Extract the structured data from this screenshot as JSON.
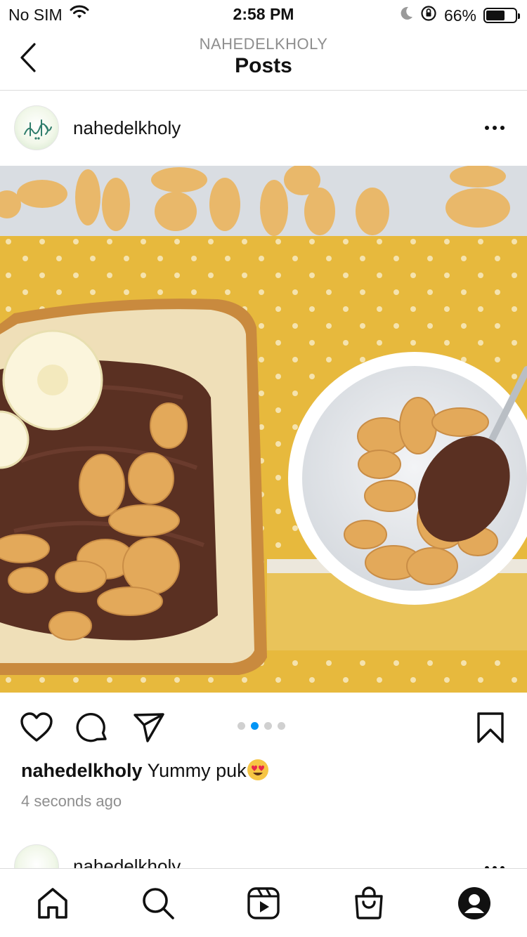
{
  "status_bar": {
    "carrier": "No SIM",
    "time": "2:58 PM",
    "battery_percent": "66%",
    "battery_level": 0.66,
    "icons": [
      "wifi-icon",
      "moon-icon",
      "orientation-lock-icon",
      "battery-icon"
    ]
  },
  "nav": {
    "subtitle": "NAHEDELKHOLY",
    "title": "Posts",
    "back_icon": "chevron-left-icon"
  },
  "post": {
    "username": "nahedelkholy",
    "more_icon": "more-horizontal-icon",
    "image_alt": "post-photo",
    "carousel": {
      "count": 4,
      "active_index": 1
    },
    "caption": {
      "username": "nahedelkholy",
      "text": "Yummy puk",
      "emoji": "heart-eyes-emoji"
    },
    "timestamp": "4 seconds ago",
    "actions": [
      "heart-icon",
      "comment-icon",
      "share-icon",
      "bookmark-icon"
    ]
  },
  "next_post": {
    "username": "nahedelkholy"
  },
  "tab_bar": {
    "tabs": [
      "home-icon",
      "search-icon",
      "reels-icon",
      "shop-icon",
      "profile-icon"
    ]
  },
  "colors": {
    "accent": "#0095f6",
    "divider": "#dbdbdb",
    "muted": "#8e8e8e",
    "yellow_cloth": "#e7b93d"
  }
}
